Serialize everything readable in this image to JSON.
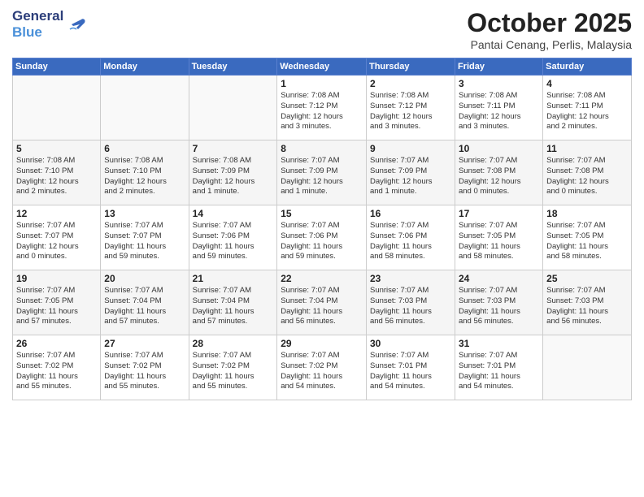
{
  "header": {
    "logo_line1": "General",
    "logo_line2": "Blue",
    "month_title": "October 2025",
    "subtitle": "Pantai Cenang, Perlis, Malaysia"
  },
  "weekdays": [
    "Sunday",
    "Monday",
    "Tuesday",
    "Wednesday",
    "Thursday",
    "Friday",
    "Saturday"
  ],
  "weeks": [
    [
      {
        "day": "",
        "info": ""
      },
      {
        "day": "",
        "info": ""
      },
      {
        "day": "",
        "info": ""
      },
      {
        "day": "1",
        "info": "Sunrise: 7:08 AM\nSunset: 7:12 PM\nDaylight: 12 hours\nand 3 minutes."
      },
      {
        "day": "2",
        "info": "Sunrise: 7:08 AM\nSunset: 7:12 PM\nDaylight: 12 hours\nand 3 minutes."
      },
      {
        "day": "3",
        "info": "Sunrise: 7:08 AM\nSunset: 7:11 PM\nDaylight: 12 hours\nand 3 minutes."
      },
      {
        "day": "4",
        "info": "Sunrise: 7:08 AM\nSunset: 7:11 PM\nDaylight: 12 hours\nand 2 minutes."
      }
    ],
    [
      {
        "day": "5",
        "info": "Sunrise: 7:08 AM\nSunset: 7:10 PM\nDaylight: 12 hours\nand 2 minutes."
      },
      {
        "day": "6",
        "info": "Sunrise: 7:08 AM\nSunset: 7:10 PM\nDaylight: 12 hours\nand 2 minutes."
      },
      {
        "day": "7",
        "info": "Sunrise: 7:08 AM\nSunset: 7:09 PM\nDaylight: 12 hours\nand 1 minute."
      },
      {
        "day": "8",
        "info": "Sunrise: 7:07 AM\nSunset: 7:09 PM\nDaylight: 12 hours\nand 1 minute."
      },
      {
        "day": "9",
        "info": "Sunrise: 7:07 AM\nSunset: 7:09 PM\nDaylight: 12 hours\nand 1 minute."
      },
      {
        "day": "10",
        "info": "Sunrise: 7:07 AM\nSunset: 7:08 PM\nDaylight: 12 hours\nand 0 minutes."
      },
      {
        "day": "11",
        "info": "Sunrise: 7:07 AM\nSunset: 7:08 PM\nDaylight: 12 hours\nand 0 minutes."
      }
    ],
    [
      {
        "day": "12",
        "info": "Sunrise: 7:07 AM\nSunset: 7:07 PM\nDaylight: 12 hours\nand 0 minutes."
      },
      {
        "day": "13",
        "info": "Sunrise: 7:07 AM\nSunset: 7:07 PM\nDaylight: 11 hours\nand 59 minutes."
      },
      {
        "day": "14",
        "info": "Sunrise: 7:07 AM\nSunset: 7:06 PM\nDaylight: 11 hours\nand 59 minutes."
      },
      {
        "day": "15",
        "info": "Sunrise: 7:07 AM\nSunset: 7:06 PM\nDaylight: 11 hours\nand 59 minutes."
      },
      {
        "day": "16",
        "info": "Sunrise: 7:07 AM\nSunset: 7:06 PM\nDaylight: 11 hours\nand 58 minutes."
      },
      {
        "day": "17",
        "info": "Sunrise: 7:07 AM\nSunset: 7:05 PM\nDaylight: 11 hours\nand 58 minutes."
      },
      {
        "day": "18",
        "info": "Sunrise: 7:07 AM\nSunset: 7:05 PM\nDaylight: 11 hours\nand 58 minutes."
      }
    ],
    [
      {
        "day": "19",
        "info": "Sunrise: 7:07 AM\nSunset: 7:05 PM\nDaylight: 11 hours\nand 57 minutes."
      },
      {
        "day": "20",
        "info": "Sunrise: 7:07 AM\nSunset: 7:04 PM\nDaylight: 11 hours\nand 57 minutes."
      },
      {
        "day": "21",
        "info": "Sunrise: 7:07 AM\nSunset: 7:04 PM\nDaylight: 11 hours\nand 57 minutes."
      },
      {
        "day": "22",
        "info": "Sunrise: 7:07 AM\nSunset: 7:04 PM\nDaylight: 11 hours\nand 56 minutes."
      },
      {
        "day": "23",
        "info": "Sunrise: 7:07 AM\nSunset: 7:03 PM\nDaylight: 11 hours\nand 56 minutes."
      },
      {
        "day": "24",
        "info": "Sunrise: 7:07 AM\nSunset: 7:03 PM\nDaylight: 11 hours\nand 56 minutes."
      },
      {
        "day": "25",
        "info": "Sunrise: 7:07 AM\nSunset: 7:03 PM\nDaylight: 11 hours\nand 56 minutes."
      }
    ],
    [
      {
        "day": "26",
        "info": "Sunrise: 7:07 AM\nSunset: 7:02 PM\nDaylight: 11 hours\nand 55 minutes."
      },
      {
        "day": "27",
        "info": "Sunrise: 7:07 AM\nSunset: 7:02 PM\nDaylight: 11 hours\nand 55 minutes."
      },
      {
        "day": "28",
        "info": "Sunrise: 7:07 AM\nSunset: 7:02 PM\nDaylight: 11 hours\nand 55 minutes."
      },
      {
        "day": "29",
        "info": "Sunrise: 7:07 AM\nSunset: 7:02 PM\nDaylight: 11 hours\nand 54 minutes."
      },
      {
        "day": "30",
        "info": "Sunrise: 7:07 AM\nSunset: 7:01 PM\nDaylight: 11 hours\nand 54 minutes."
      },
      {
        "day": "31",
        "info": "Sunrise: 7:07 AM\nSunset: 7:01 PM\nDaylight: 11 hours\nand 54 minutes."
      },
      {
        "day": "",
        "info": ""
      }
    ]
  ]
}
